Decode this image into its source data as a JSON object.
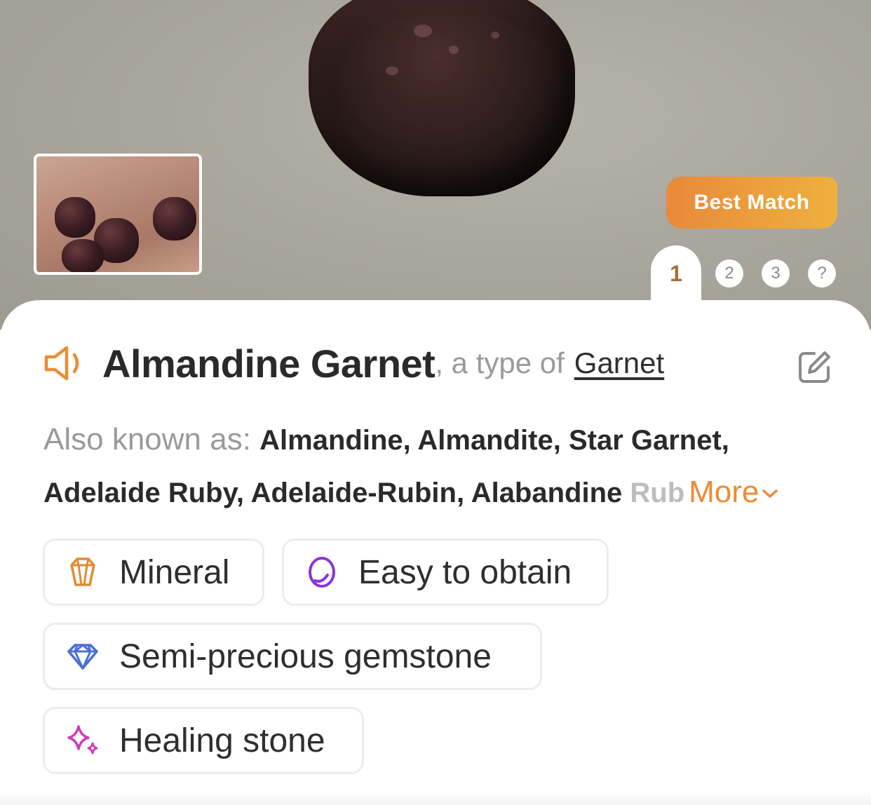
{
  "hero": {
    "badge_label": "Best Match",
    "pager": {
      "active": "1",
      "pages": [
        "2",
        "3",
        "?"
      ]
    }
  },
  "result": {
    "name": "Almandine Garnet",
    "type_prefix": ", a type of",
    "type_link": "Garnet",
    "aka_label": "Also known as: ",
    "aka_line1": "Almandine, Almandite, Star Garnet,",
    "aka_line2": "Adelaide Ruby, Adelaide-Rubin, Alabandine ",
    "aka_fade": "Rub",
    "more_label": "More"
  },
  "tags": [
    {
      "label": "Mineral",
      "icon": "crystal-icon",
      "color": "#e28a35"
    },
    {
      "label": "Easy to obtain",
      "icon": "ring-icon",
      "color": "#8b34d6"
    },
    {
      "label": "Semi-precious gemstone",
      "icon": "diamond-icon",
      "color": "#4a6fd8"
    },
    {
      "label": "Healing stone",
      "icon": "sparkle-icon",
      "color": "#d03bb6"
    }
  ],
  "colors": {
    "accent": "#ec8b32",
    "badge_gradient_start": "#e8893a",
    "badge_gradient_end": "#efb03f",
    "pager_active": "#a0723c"
  }
}
